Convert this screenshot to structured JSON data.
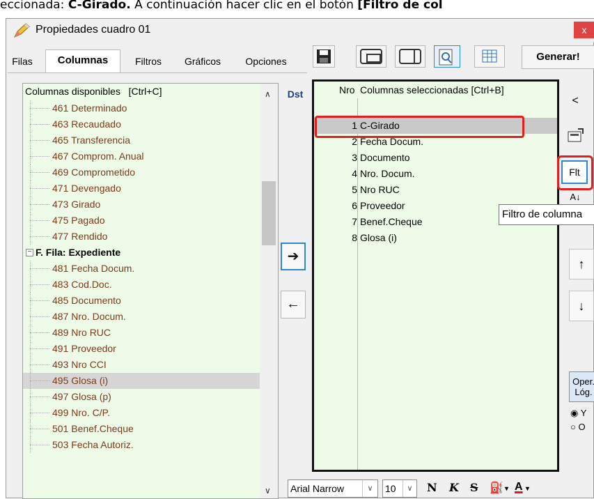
{
  "caption": {
    "prefix": "eccionada: ",
    "bold_part": "C-Girado.",
    "middle": " A continuación hacer clic en el botón ",
    "bold_end": "[Filtro de col"
  },
  "window": {
    "title": "Propiedades cuadro 01",
    "close_label": "x"
  },
  "tabs": [
    {
      "label": "Filas",
      "active": false
    },
    {
      "label": "Columnas",
      "active": true
    },
    {
      "label": "Filtros",
      "active": false
    },
    {
      "label": "Gráficos",
      "active": false
    },
    {
      "label": "Opciones",
      "active": false
    }
  ],
  "toolbar": {
    "generate_label": "Generar!",
    "icons": [
      "save-icon",
      "layout-icon",
      "split-icon",
      "preview-icon",
      "table-icon"
    ]
  },
  "available": {
    "header": "Columnas disponibles   [Ctrl+C]",
    "items": [
      {
        "label": "461 Determinado",
        "type": "item"
      },
      {
        "label": "463 Recaudado",
        "type": "item"
      },
      {
        "label": "465 Transferencia",
        "type": "item"
      },
      {
        "label": "467 Comprom. Anual",
        "type": "item"
      },
      {
        "label": "469 Comprometido",
        "type": "item"
      },
      {
        "label": "471 Devengado",
        "type": "item"
      },
      {
        "label": "473 Girado",
        "type": "item"
      },
      {
        "label": "475 Pagado",
        "type": "item"
      },
      {
        "label": "477 Rendido",
        "type": "item"
      },
      {
        "label": "F. Fila: Expediente",
        "type": "group"
      },
      {
        "label": "481 Fecha Docum.",
        "type": "item"
      },
      {
        "label": "483 Cod.Doc.",
        "type": "item"
      },
      {
        "label": "485 Documento",
        "type": "item"
      },
      {
        "label": "487 Nro. Docum.",
        "type": "item"
      },
      {
        "label": "489 Nro RUC",
        "type": "item"
      },
      {
        "label": "491 Proveedor",
        "type": "item"
      },
      {
        "label": "493 Nro CCI",
        "type": "item"
      },
      {
        "label": "495 Glosa (i)",
        "type": "item",
        "selected": true
      },
      {
        "label": "497 Glosa (p)",
        "type": "item"
      },
      {
        "label": "499 Nro. C/P.",
        "type": "item"
      },
      {
        "label": "501 Benef.Cheque",
        "type": "item"
      },
      {
        "label": "503 Fecha Autoriz.",
        "type": "item"
      }
    ]
  },
  "dst_label": "Dst",
  "arrows": {
    "right": "➔",
    "left": "🡐"
  },
  "selected_columns": {
    "header_nro": "Nro",
    "header_cols": "Columnas seleccionadas   [Ctrl+B]",
    "rows": [
      {
        "num": "1",
        "name": "C-Girado",
        "selected": true
      },
      {
        "num": "2",
        "name": "Fecha Docum."
      },
      {
        "num": "3",
        "name": "Documento"
      },
      {
        "num": "4",
        "name": "Nro. Docum."
      },
      {
        "num": "5",
        "name": "Nro RUC"
      },
      {
        "num": "6",
        "name": "Proveedor"
      },
      {
        "num": "7",
        "name": "Benef.Cheque"
      },
      {
        "num": "8",
        "name": "Glosa (i)"
      }
    ]
  },
  "side": {
    "collapse_label": "<",
    "flt_label": "Flt",
    "az_label": "A↓",
    "tooltip": "Filtro de columna",
    "up_label": "↑",
    "down_label": "↓",
    "oper_label_1": "Oper.",
    "oper_label_2": "Lóg.",
    "radio_y": "Y",
    "radio_o": "O",
    "radio_selected": "Y"
  },
  "font": {
    "name": "Arial Narrow",
    "size": "10",
    "bold": "N",
    "italic": "K",
    "strike": "S",
    "fill_glyph": "⛽",
    "color_glyph": "A"
  }
}
